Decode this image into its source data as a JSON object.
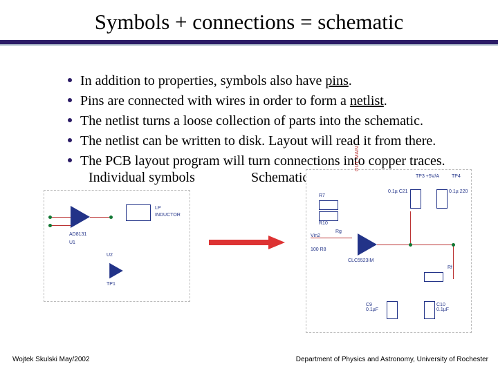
{
  "title": "Symbols + connections = schematic",
  "bullets": [
    {
      "pre": "In addition to properties, symbols also have ",
      "u": "pins",
      "post": "."
    },
    {
      "pre": "Pins are connected with wires in order to form a ",
      "u": "netlist",
      "post": "."
    },
    {
      "pre": "The netlist turns a loose collection of parts into the schematic.",
      "u": "",
      "post": ""
    },
    {
      "pre": "The netlist can be written to disk. Layout will read it from there.",
      "u": "",
      "post": ""
    },
    {
      "pre": "The PCB layout program will turn connections into copper traces.",
      "u": "",
      "post": ""
    }
  ],
  "labels": {
    "individual": "Individual symbols",
    "schematic": "Schematic"
  },
  "diagrams": {
    "left": {
      "caption_upper": "LP",
      "caption_lower": "INDUCTOR",
      "opamp": "AD8131",
      "ref_u1": "U1",
      "ref_u2": "U2",
      "ref_tp1": "TP1"
    },
    "right": {
      "net_main": "OUT_MAIN",
      "rg": "Rg",
      "r10": "100 R8",
      "opamp": "CLC5523IM",
      "rf": "Rf",
      "c9": "C9\n0.1µF",
      "c10": "C10\n0.1µF",
      "r7": "R7",
      "r10v": "R10",
      "cap1": "0.1µ C21",
      "cap2": "0.1µ 220",
      "tp3": "TP3  +5V/A",
      "tp4": "TP4",
      "vin2": "Vin2"
    }
  },
  "footer": {
    "left": "Wojtek Skulski May/2002",
    "right": "Department of Physics and Astronomy, University of Rochester"
  }
}
